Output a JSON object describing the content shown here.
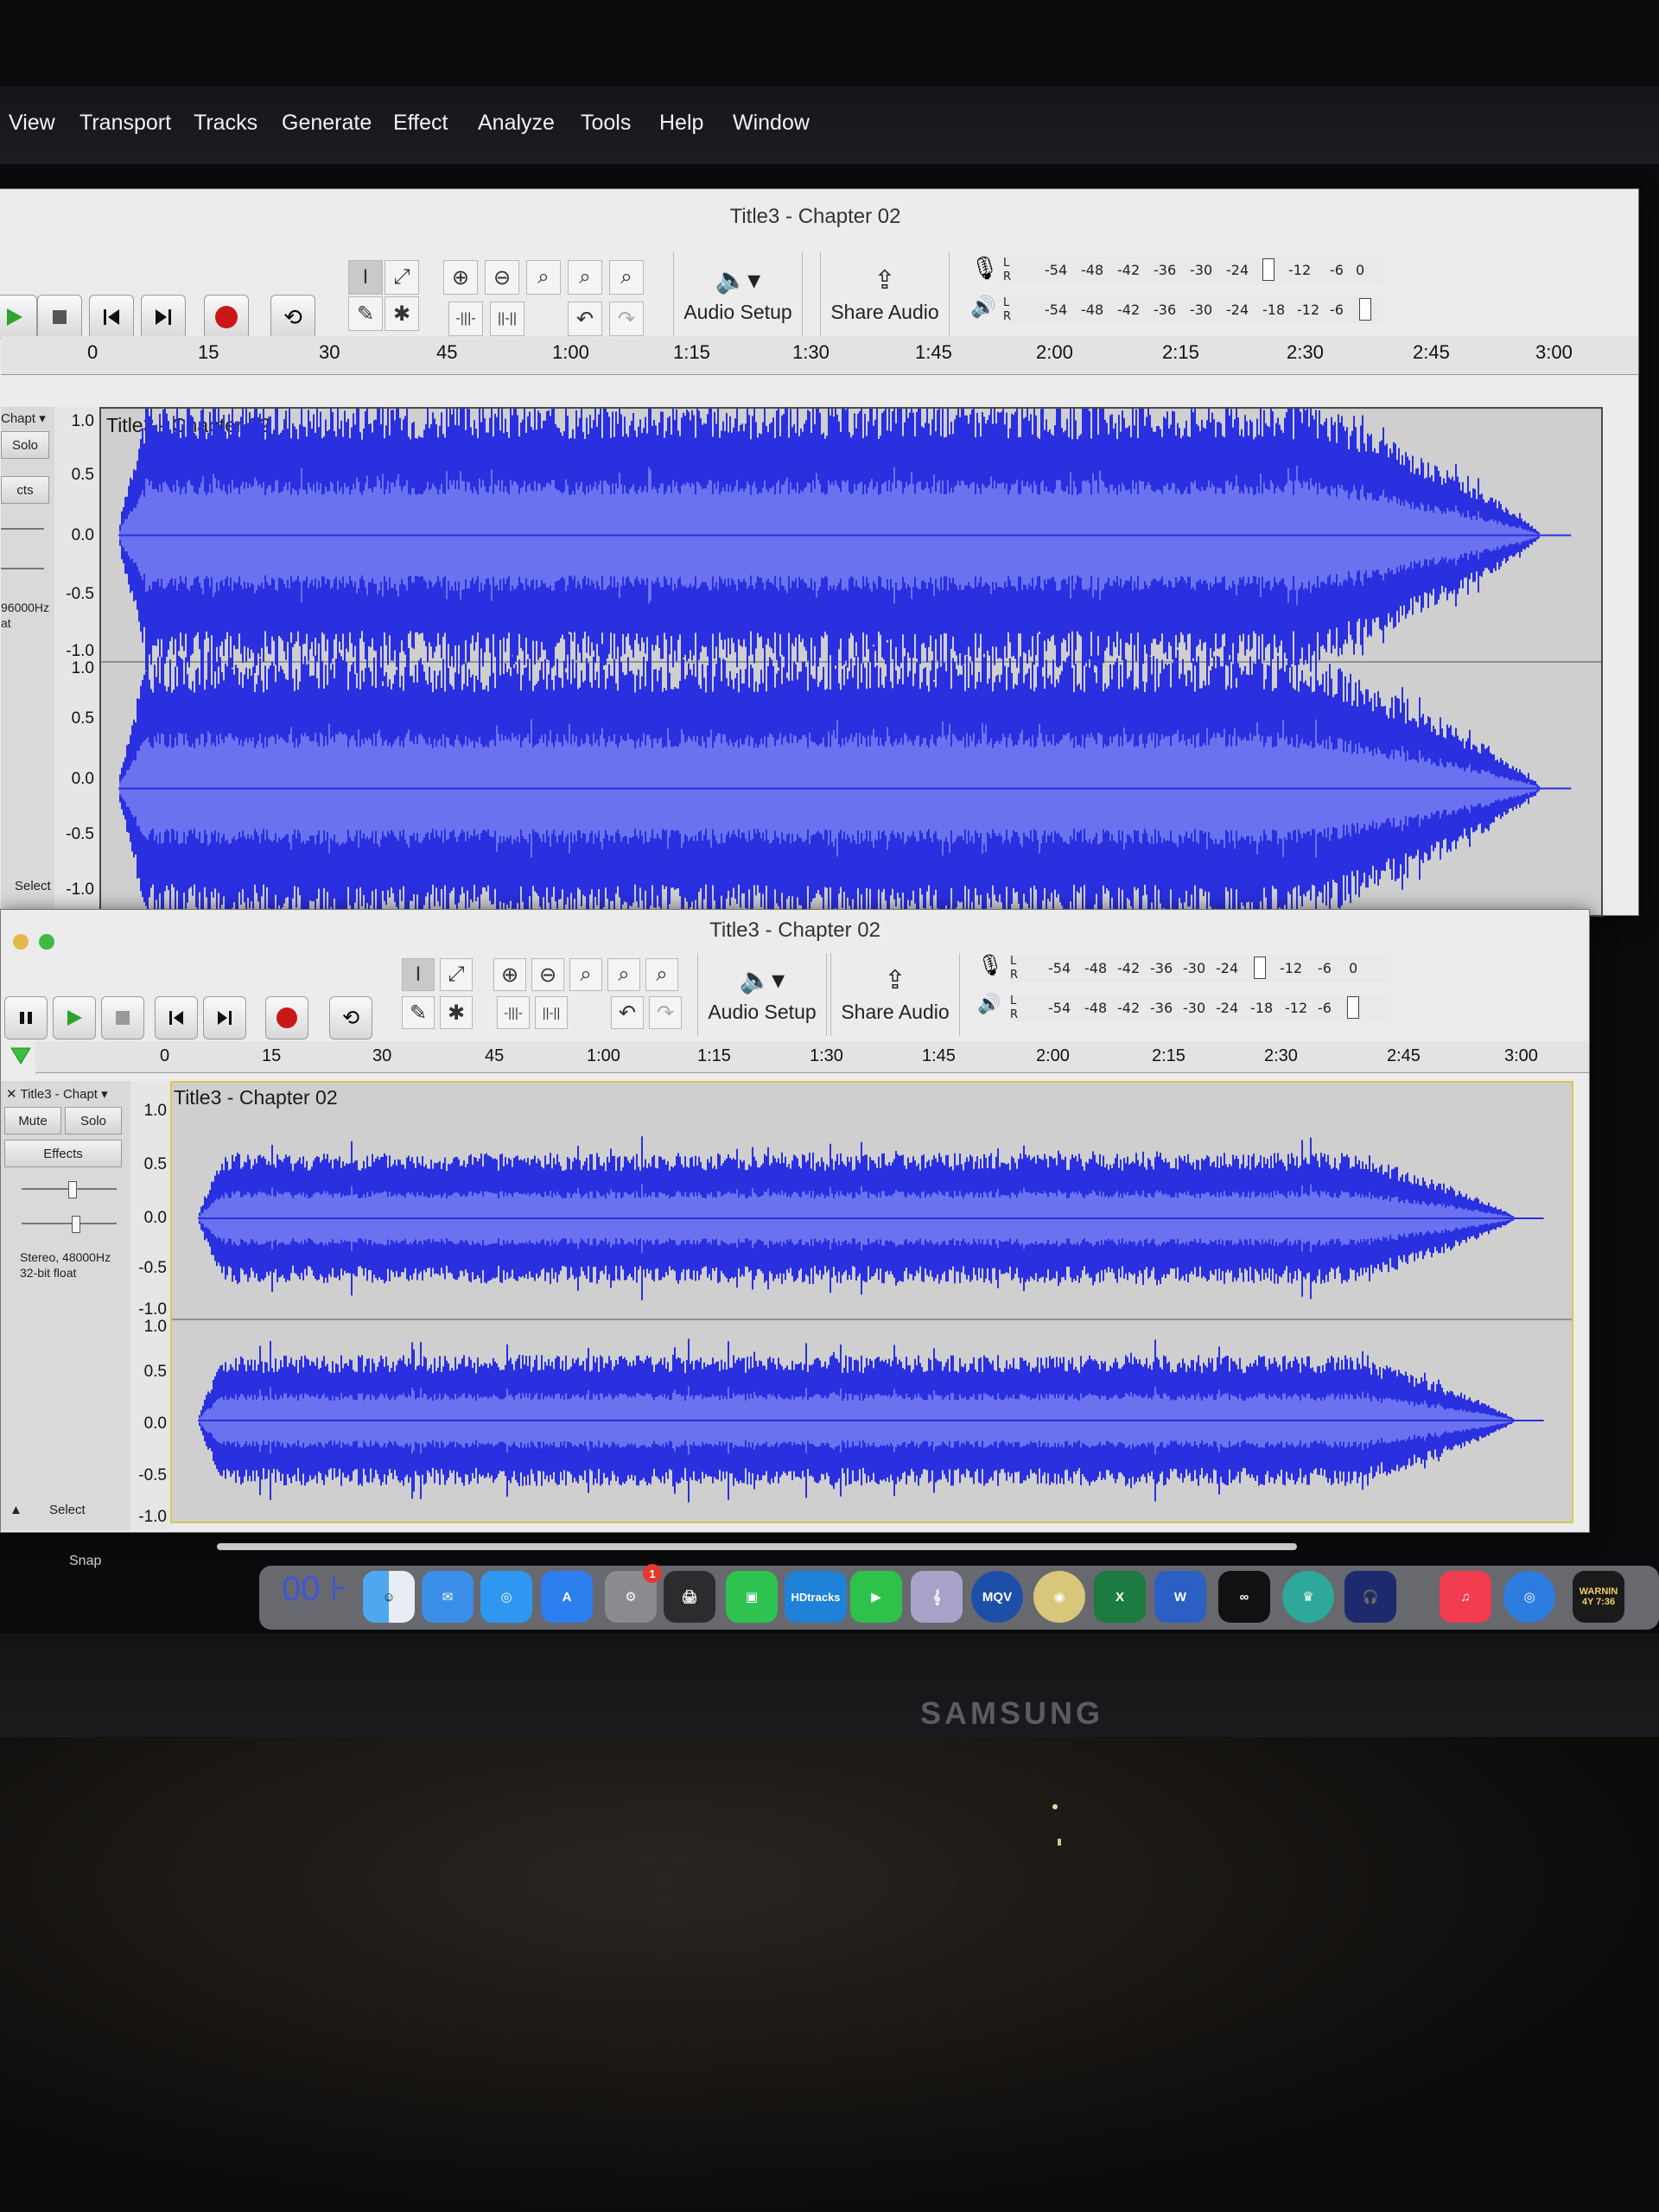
{
  "menu": [
    "View",
    "Transport",
    "Tracks",
    "Generate",
    "Effect",
    "Analyze",
    "Tools",
    "Help",
    "Window"
  ],
  "windows": [
    {
      "title": "Title3 - Chapter 02",
      "audio_setup_label": "Audio Setup",
      "share_audio_label": "Share Audio",
      "ruler": [
        "0",
        "15",
        "30",
        "45",
        "1:00",
        "1:15",
        "1:30",
        "1:45",
        "2:00",
        "2:15",
        "2:30",
        "2:45",
        "3:00"
      ],
      "track": {
        "name": "Chapt",
        "solo_label": "Solo",
        "effects_label": "cts",
        "format_line1": "96000Hz",
        "format_line2": "at",
        "select_label": "Select",
        "clip_title": "Title3 - Chapter 02",
        "scale_top": [
          "1.0",
          "0.5",
          "0.0",
          "-0.5",
          "-1.0"
        ],
        "scale_bottom": [
          "1.0",
          "0.5",
          "0.0",
          "-0.5",
          "-1.0"
        ]
      }
    },
    {
      "title": "Title3 - Chapter 02",
      "audio_setup_label": "Audio Setup",
      "share_audio_label": "Share Audio",
      "ruler": [
        "0",
        "15",
        "30",
        "45",
        "1:00",
        "1:15",
        "1:30",
        "1:45",
        "2:00",
        "2:15",
        "2:30",
        "2:45",
        "3:00"
      ],
      "track": {
        "name": "Title3 - Chapt",
        "mute_label": "Mute",
        "solo_label": "Solo",
        "effects_label": "Effects",
        "format_line1": "Stereo, 48000Hz",
        "format_line2": "32-bit float",
        "select_label": "Select",
        "clip_title": "Title3 - Chapter 02",
        "scale_top": [
          "1.0",
          "0.5",
          "0.0",
          "-0.5",
          "-1.0"
        ],
        "scale_bottom": [
          "1.0",
          "0.5",
          "0.0",
          "-0.5",
          "-1.0"
        ]
      }
    }
  ],
  "meter_ticks": [
    "-54",
    "-48",
    "-42",
    "-36",
    "-30",
    "-24",
    "-18",
    "-12",
    "-6",
    "0"
  ],
  "meter_channels": [
    "L",
    "R"
  ],
  "snap_label": "Snap",
  "dock": {
    "badge_count": "1",
    "hdtracks_label": "HDtracks",
    "mqv_label": "MQV",
    "excel_label": "X",
    "word_label": "W",
    "warning_label": "WARNIN",
    "clock_label": "4Y 7:36",
    "mirrored_text": "00 ⊦"
  },
  "monitor_brand": "SAMSUNG",
  "colors": {
    "wave_fill": "#2a2fe0",
    "wave_rms": "#6b72f0",
    "record_red": "#c81818",
    "play_green": "#2ea32e"
  }
}
